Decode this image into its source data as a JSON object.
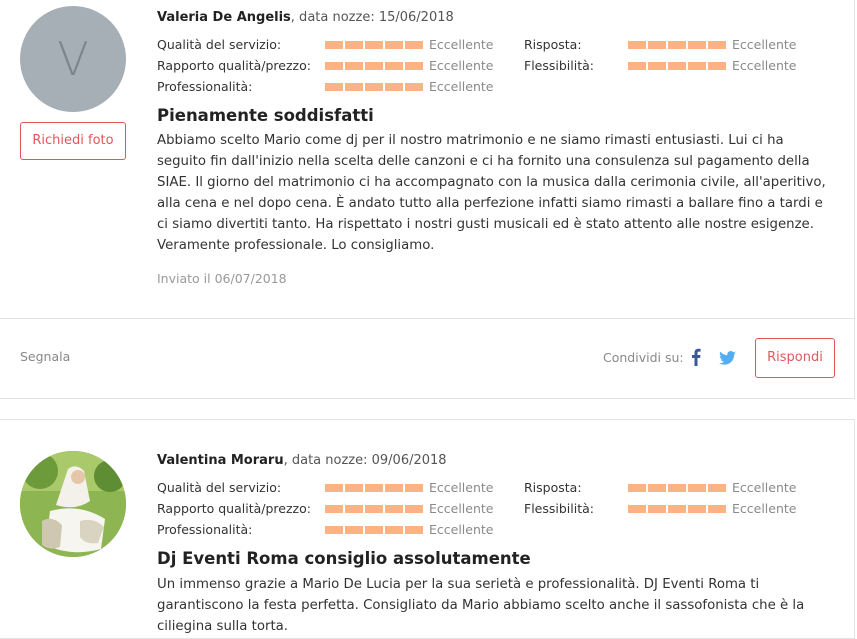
{
  "reviews": [
    {
      "avatar_letter": "V",
      "request_photo_label": "Richiedi foto",
      "author": "Valeria De Angelis",
      "wedding_date": ", data nozze: 15/06/2018",
      "ratings": [
        {
          "label": "Qualità del servizio:",
          "value": "Eccellente",
          "score": 5
        },
        {
          "label": "Rapporto qualità/prezzo:",
          "value": "Eccellente",
          "score": 5
        },
        {
          "label": "Professionalità:",
          "value": "Eccellente",
          "score": 5
        },
        {
          "label": "Risposta:",
          "value": "Eccellente",
          "score": 5
        },
        {
          "label": "Flessibilità:",
          "value": "Eccellente",
          "score": 5
        }
      ],
      "title": "Pienamente soddisfatti",
      "text": "Abbiamo scelto Mario come dj per il nostro matrimonio e ne siamo rimasti entusiasti. Lui ci ha seguito fin dall'inizio nella scelta delle canzoni e ci ha fornito una consulenza sul pagamento della SIAE. Il giorno del matrimonio ci ha accompagnato con la musica dalla cerimonia civile, all'aperitivo, alla cena e nel dopo cena. È andato tutto alla perfezione infatti siamo rimasti a ballare fino a tardi e ci siamo divertiti tanto. Ha rispettato i nostri gusti musicali ed è stato attento alle nostre esigenze. Veramente professionale. Lo consigliamo.",
      "sent": "Inviato il 06/07/2018",
      "report_label": "Segnala",
      "share_label": "Condividi su:",
      "reply_label": "Rispondi"
    },
    {
      "author": "Valentina Moraru",
      "wedding_date": ", data nozze: 09/06/2018",
      "ratings": [
        {
          "label": "Qualità del servizio:",
          "value": "Eccellente",
          "score": 5
        },
        {
          "label": "Rapporto qualità/prezzo:",
          "value": "Eccellente",
          "score": 5
        },
        {
          "label": "Professionalità:",
          "value": "Eccellente",
          "score": 5
        },
        {
          "label": "Risposta:",
          "value": "Eccellente",
          "score": 5
        },
        {
          "label": "Flessibilità:",
          "value": "Eccellente",
          "score": 5
        }
      ],
      "title": "Dj Eventi Roma consiglio assolutamente",
      "text": "Un immenso grazie a Mario De Lucia per la sua serietà e professionalità. DJ Eventi Roma ti garantiscono la festa perfetta. Consigliato da Mario abbiamo scelto anche il sassofonista che è la ciliegina sulla torta."
    }
  ],
  "colors": {
    "accent": "#e0575e",
    "rating_bar": "#f9b384",
    "facebook": "#3b5998",
    "twitter": "#55acee"
  }
}
